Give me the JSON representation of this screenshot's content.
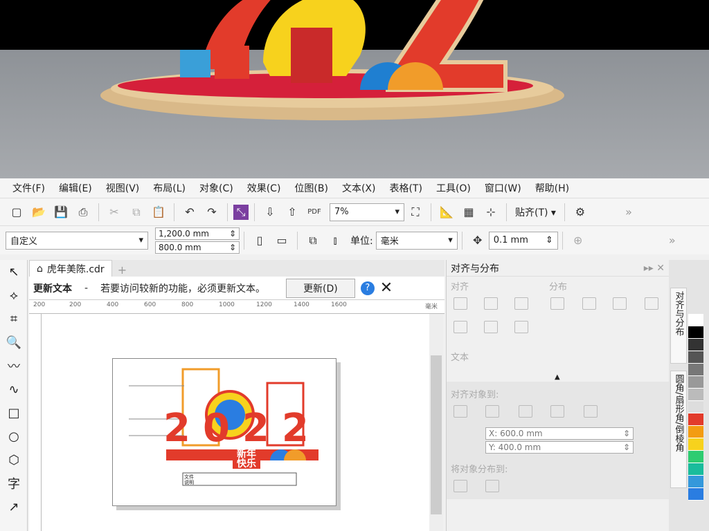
{
  "menu": [
    "文件(F)",
    "编辑(E)",
    "视图(V)",
    "布局(L)",
    "对象(C)",
    "效果(C)",
    "位图(B)",
    "文本(X)",
    "表格(T)",
    "工具(O)",
    "窗口(W)",
    "帮助(H)"
  ],
  "toolbar": {
    "zoom": "7%",
    "snap": "贴齐(T)"
  },
  "props": {
    "page_size": "自定义",
    "width": "1,200.0 mm",
    "height": "800.0 mm",
    "units_label": "单位:",
    "units": "毫米",
    "nudge": "0.1 mm"
  },
  "doc": {
    "tab": "虎年美陈.cdr"
  },
  "notice": {
    "title": "更新文本",
    "dash": "-",
    "message": "若要访问较新的功能，必须更新文本。",
    "button": "更新(D)"
  },
  "ruler": {
    "ticks": [
      "200",
      "200",
      "400",
      "600",
      "800",
      "1000",
      "1200",
      "1400",
      "1600"
    ],
    "unit": "毫米"
  },
  "artwork": {
    "year": "2022",
    "greeting": "新年快乐",
    "note_label": "文件说明"
  },
  "render_scene": {
    "year": "2022",
    "greeting": "新年快乐"
  },
  "panel": {
    "title": "对齐与分布",
    "align": "对齐",
    "distribute": "分布",
    "text": "文本",
    "align_to": "对齐对象到:",
    "x": "600.0 mm",
    "y": "400.0 mm",
    "distribute_to": "将对象分布到:"
  },
  "side_tabs": {
    "tab1": "对齐与分布",
    "tab2": "圆角/扇形角/倒棱角"
  },
  "colors": {
    "accent": "#2a7de1",
    "red": "#e23b2b",
    "yellow": "#f7d21d",
    "palette": [
      "#ffffff",
      "#000000",
      "#333333",
      "#555555",
      "#777777",
      "#999999",
      "#bbbbbb",
      "#dddddd",
      "#e23b2b",
      "#f39c12",
      "#f7d21d",
      "#2ecc71",
      "#1abc9c",
      "#3498db",
      "#2a7de1"
    ]
  }
}
